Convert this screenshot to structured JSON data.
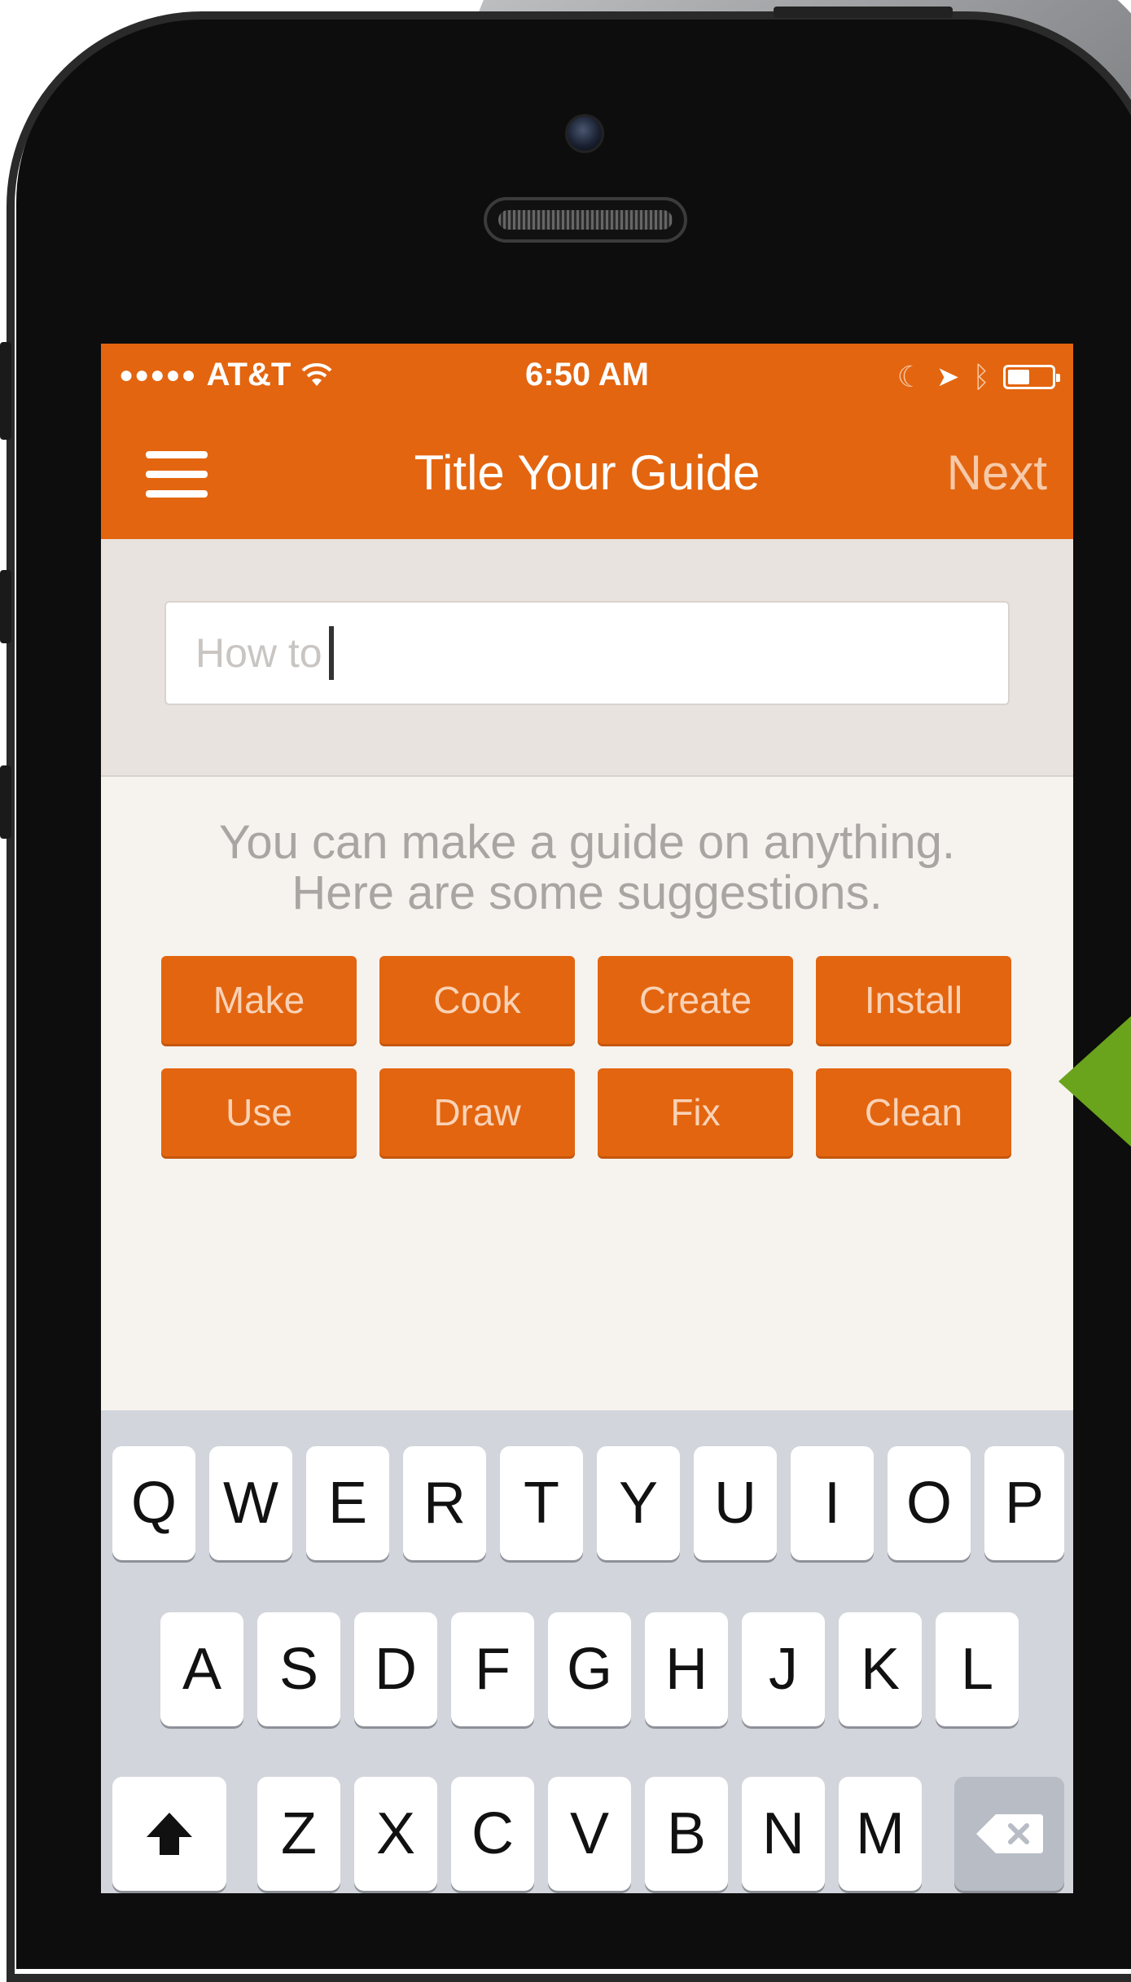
{
  "status_bar": {
    "carrier": "AT&T",
    "signal_dots": "●●●●●",
    "time": "6:50 AM"
  },
  "nav": {
    "title": "Title Your Guide",
    "next_label": "Next",
    "menu_icon": "hamburger-menu-icon"
  },
  "title_input": {
    "placeholder": "How to"
  },
  "suggestions": {
    "line1": "You can make a guide on anything.",
    "line2": "Here are some suggestions.",
    "chips": [
      "Make",
      "Cook",
      "Create",
      "Install",
      "Use",
      "Draw",
      "Fix",
      "Clean"
    ]
  },
  "keyboard": {
    "row1": [
      "Q",
      "W",
      "E",
      "R",
      "T",
      "Y",
      "U",
      "I",
      "O",
      "P"
    ],
    "row2": [
      "A",
      "S",
      "D",
      "F",
      "G",
      "H",
      "J",
      "K",
      "L"
    ],
    "row3": [
      "Z",
      "X",
      "C",
      "V",
      "B",
      "N",
      "M"
    ],
    "shift_icon": "shift-arrow-icon",
    "delete_icon": "backspace-icon"
  },
  "colors": {
    "accent": "#e3650f",
    "callout": "#6aa31c"
  }
}
